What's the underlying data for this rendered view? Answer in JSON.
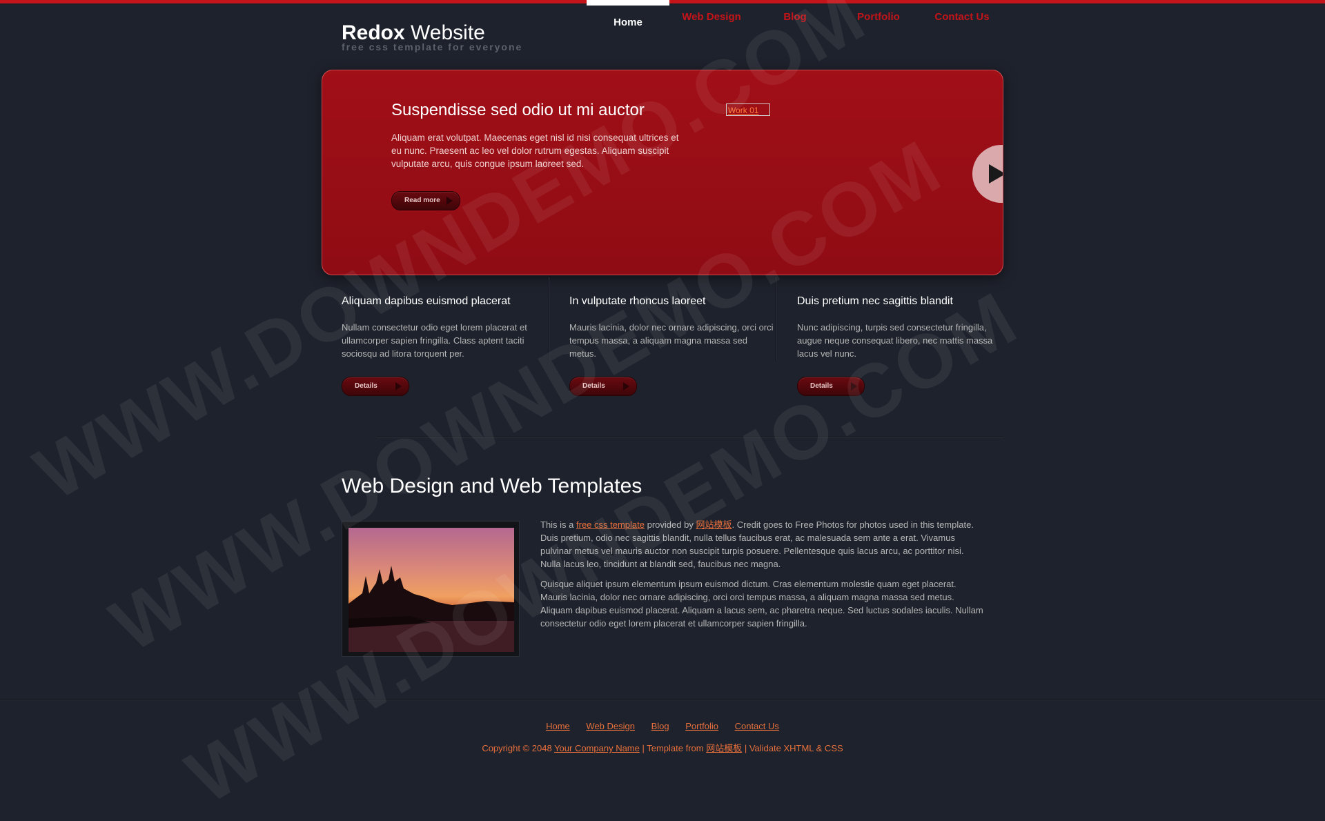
{
  "logo": {
    "bold": "Redox",
    "light": "Website",
    "tagline": "free css template for everyone"
  },
  "nav": [
    "Home",
    "Web Design",
    "Blog",
    "Portfolio",
    "Contact Us"
  ],
  "banner": {
    "title": "Suspendisse sed odio ut mi auctor",
    "text": "Aliquam erat volutpat. Maecenas eget nisl id nisi consequat ultrices et eu nunc. Praesent ac leo vel dolor rutrum egestas. Aliquam suscipit vulputate arcu, quis congue ipsum laoreet sed.",
    "button": "Read more",
    "image_alt": "Work 01",
    "next_icon": "play-icon"
  },
  "columns": [
    {
      "title": "Aliquam dapibus euismod placerat",
      "text": "Nullam consectetur odio eget lorem placerat et ullamcorper sapien fringilla. Class aptent taciti sociosqu ad litora torquent per.",
      "button": "Details"
    },
    {
      "title": "In vulputate rhoncus laoreet",
      "text": "Mauris lacinia, dolor nec ornare adipiscing, orci orci tempus massa, a aliquam magna massa sed metus.",
      "button": "Details"
    },
    {
      "title": "Duis pretium nec sagittis blandit",
      "text": "Nunc adipiscing, turpis sed consectetur fringilla, augue neque consequat libero, nec mattis massa lacus vel nunc.",
      "button": "Details"
    }
  ],
  "section": {
    "title": "Web Design and Web Templates",
    "p1_pre": "This is a ",
    "p1_link1": "free css template",
    "p1_mid": " provided by ",
    "p1_link2": "网站模板",
    "p1_post": ". Credit goes to Free Photos for photos used in this template. Duis pretium, odio nec sagittis blandit, nulla tellus faucibus erat, ac malesuada sem ante a erat. Vivamus pulvinar metus vel mauris auctor non suscipit turpis posuere. Pellentesque quis lacus arcu, ac porttitor nisi. Nulla lacus leo, tincidunt at blandit sed, faucibus nec magna.",
    "p2": "Quisque aliquet ipsum elementum ipsum euismod dictum. Cras elementum molestie quam eget placerat. Mauris lacinia, dolor nec ornare adipiscing, orci orci tempus massa, a aliquam magna massa sed metus. Aliquam dapibus euismod placerat. Aliquam a lacus sem, ac pharetra neque. Sed luctus sodales iaculis. Nullam consectetur odio eget lorem placerat et ullamcorper sapien fringilla."
  },
  "footer": {
    "links": [
      "Home",
      "Web Design",
      "Blog",
      "Portfolio",
      "Contact Us"
    ],
    "copy_pre": "Copyright © 2048 ",
    "company_link": "Your Company Name",
    "copy_mid": " | Template from ",
    "template_link": "网站模板",
    "copy_post": " | Validate XHTML & CSS"
  },
  "watermark": "WWW.DOWNDEMO.COM",
  "colors": {
    "accent": "#c4141a",
    "link": "#e8703c",
    "background": "#1e222c"
  }
}
